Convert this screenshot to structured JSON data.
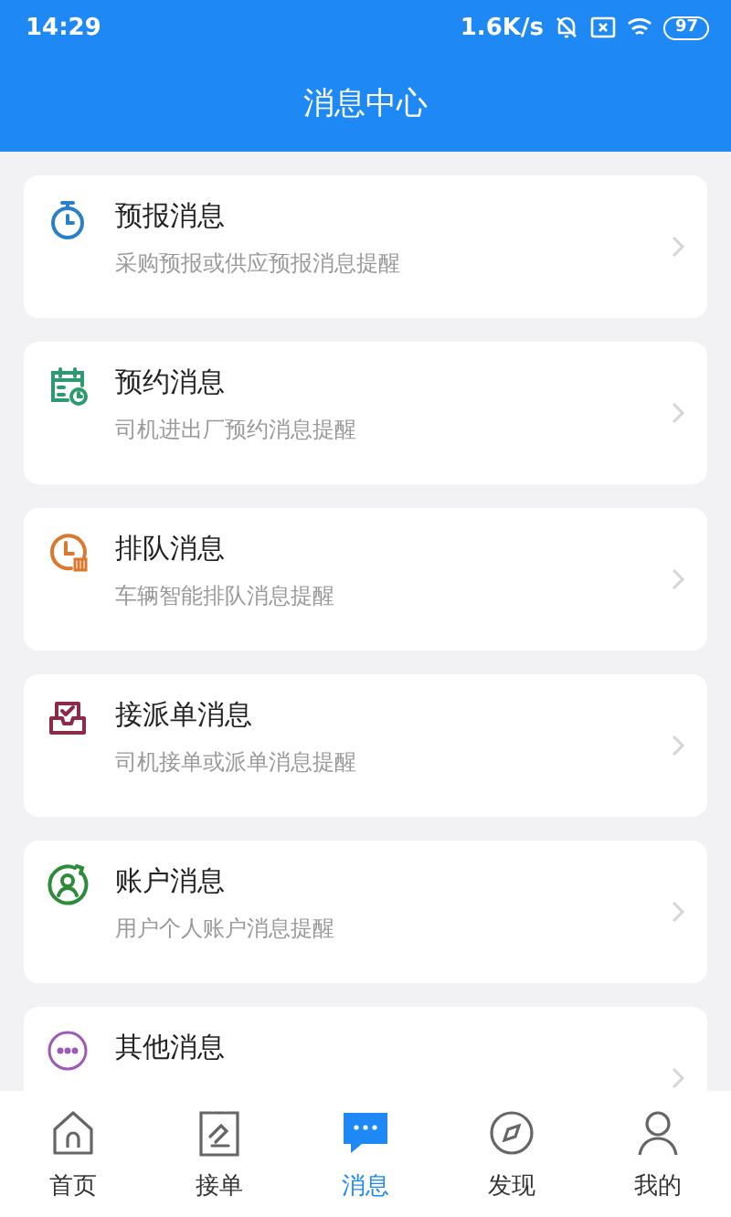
{
  "status_bar": {
    "time": "14:29",
    "speed": "1.6K/s",
    "battery": "97"
  },
  "header": {
    "title": "消息中心"
  },
  "messages": [
    {
      "kind": "forecast",
      "title": "预报消息",
      "subtitle": "采购预报或供应预报消息提醒"
    },
    {
      "kind": "appointment",
      "title": "预约消息",
      "subtitle": "司机进出厂预约消息提醒"
    },
    {
      "kind": "queue",
      "title": "排队消息",
      "subtitle": "车辆智能排队消息提醒"
    },
    {
      "kind": "dispatch",
      "title": "接派单消息",
      "subtitle": "司机接单或派单消息提醒"
    },
    {
      "kind": "account",
      "title": "账户消息",
      "subtitle": "用户个人账户消息提醒"
    },
    {
      "kind": "other",
      "title": "其他消息"
    }
  ],
  "tab_bar": [
    {
      "kind": "home",
      "label": "首页",
      "selected": false
    },
    {
      "kind": "orders",
      "label": "接单",
      "selected": false
    },
    {
      "kind": "messages",
      "label": "消息",
      "selected": true
    },
    {
      "kind": "discover",
      "label": "发现",
      "selected": false
    },
    {
      "kind": "profile",
      "label": "我的",
      "selected": false
    }
  ]
}
